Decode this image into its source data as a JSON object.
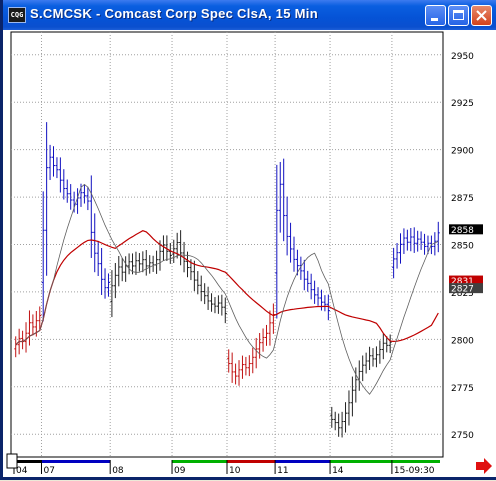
{
  "window": {
    "title": "S.CMCSK - Comcast Corp Spec ClsA, 15 Min",
    "icon_label": "CQG",
    "buttons": [
      "minimize-icon",
      "maximize-icon",
      "close-icon"
    ]
  },
  "colors": {
    "up": "#1010c0",
    "down": "#c01010",
    "neutral": "#202020",
    "moving_average": "#c00000",
    "band": "#606060",
    "grid": "#a0a0a0",
    "title_bar": "#0553d6"
  },
  "price_axis": {
    "labels": [
      "2950",
      "2925",
      "2900",
      "2875",
      "2850",
      "2825",
      "2800",
      "2775",
      "2750"
    ],
    "last_price_label": "2858",
    "ma_label": "2831",
    "lower_label": "2827"
  },
  "time_axis": {
    "labels": [
      "04",
      "07",
      "08",
      "09",
      "10",
      "11",
      "14",
      "15-09:30"
    ],
    "segment_colors": [
      "#000000",
      "#0000c0",
      "#ffffff",
      "#00b000",
      "#c00000",
      "#0000c0",
      "#00b000",
      "#00b000"
    ]
  },
  "scroll_arrow": "right-arrow-icon",
  "chart_data": {
    "type": "bar",
    "title": "S.CMCSK - Comcast Corp Spec ClsA, 15 Min",
    "ylim": [
      2738,
      2962
    ],
    "grid": true,
    "segments": [
      {
        "label": "04",
        "bars": 8,
        "start": 2795,
        "moves": [
          4,
          6,
          -3,
          8,
          10,
          -4,
          6,
          5
        ],
        "color": "down"
      },
      {
        "label": "07",
        "bars": 20,
        "start": 2830,
        "moves": [
          50,
          60,
          10,
          -8,
          -4,
          -10,
          -8,
          -5,
          -6,
          -4,
          6,
          5,
          -3,
          -5,
          -30,
          -20,
          -10,
          -15,
          -8,
          5
        ],
        "color": "up"
      },
      {
        "label": "08",
        "bars": 18,
        "start": 2820,
        "moves": [
          15,
          10,
          8,
          -5,
          6,
          4,
          -4,
          5,
          -3,
          4,
          -6,
          3,
          -2,
          5,
          8,
          6,
          -6,
          -4
        ],
        "color": "neutral"
      },
      {
        "label": "09",
        "bars": 16,
        "start": 2845,
        "moves": [
          5,
          6,
          -10,
          -8,
          -6,
          -4,
          -8,
          -5,
          -6,
          -4,
          -5,
          -3,
          -2,
          3,
          -4,
          -6
        ],
        "color": "neutral"
      },
      {
        "label": "10",
        "bars": 14,
        "start": 2790,
        "moves": [
          -5,
          -8,
          -4,
          6,
          5,
          -3,
          4,
          6,
          8,
          6,
          5,
          4,
          10,
          8
        ],
        "color": "down"
      },
      {
        "label": "11",
        "bars": 16,
        "start": 2835,
        "moves": [
          60,
          25,
          -30,
          -20,
          -12,
          -10,
          -6,
          -5,
          -8,
          -4,
          -6,
          -5,
          -3,
          -4,
          -2,
          -6
        ],
        "color": "up"
      },
      {
        "label": "14",
        "bars": 18,
        "start": 2760,
        "moves": [
          -4,
          -3,
          -5,
          6,
          8,
          10,
          12,
          10,
          8,
          6,
          4,
          5,
          -3,
          4,
          5,
          6,
          -2,
          3
        ],
        "color": "neutral"
      },
      {
        "label": "15-09:30",
        "bars": 14,
        "start": 2838,
        "moves": [
          8,
          6,
          8,
          6,
          -4,
          5,
          -6,
          4,
          -3,
          -4,
          3,
          -3,
          5,
          8
        ],
        "color": "up"
      }
    ]
  }
}
